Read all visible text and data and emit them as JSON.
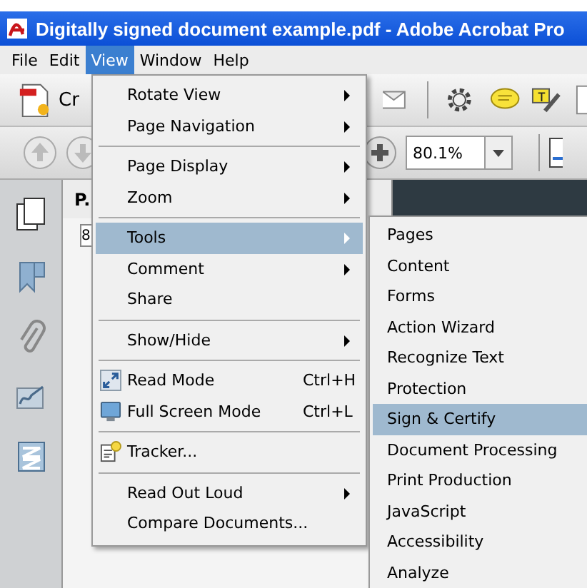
{
  "window": {
    "title": "Digitally signed document example.pdf - Adobe Acrobat Pro"
  },
  "menu_bar": [
    {
      "label": "File",
      "selected": false
    },
    {
      "label": "Edit",
      "selected": false
    },
    {
      "label": "View",
      "selected": true
    },
    {
      "label": "Window",
      "selected": false
    },
    {
      "label": "Help",
      "selected": false
    }
  ],
  "toolbar": {
    "create_label": "Cr",
    "zoom": "80.1%"
  },
  "navigation_pane": {
    "title": "P.",
    "page_field": "8"
  },
  "view_menu": [
    {
      "kind": "submenu",
      "label": "Rotate View",
      "selected": false
    },
    {
      "kind": "submenu",
      "label": "Page Navigation",
      "selected": false
    },
    {
      "kind": "separator"
    },
    {
      "kind": "submenu",
      "label": "Page Display",
      "selected": false
    },
    {
      "kind": "submenu",
      "label": "Zoom",
      "selected": false
    },
    {
      "kind": "separator"
    },
    {
      "kind": "submenu",
      "label": "Tools",
      "selected": true
    },
    {
      "kind": "submenu",
      "label": "Comment",
      "selected": false
    },
    {
      "kind": "command",
      "label": "Share",
      "selected": false
    },
    {
      "kind": "separator"
    },
    {
      "kind": "submenu",
      "label": "Show/Hide",
      "selected": false
    },
    {
      "kind": "separator"
    },
    {
      "kind": "command",
      "label": "Read Mode",
      "shortcut": "Ctrl+H",
      "selected": false
    },
    {
      "kind": "command",
      "label": "Full Screen Mode",
      "shortcut": "Ctrl+L",
      "selected": false
    },
    {
      "kind": "separator"
    },
    {
      "kind": "command",
      "label": "Tracker...",
      "selected": false
    },
    {
      "kind": "separator"
    },
    {
      "kind": "submenu",
      "label": "Read Out Loud",
      "selected": false
    },
    {
      "kind": "command",
      "label": "Compare Documents...",
      "selected": false
    }
  ],
  "tools_submenu": [
    {
      "label": "Pages",
      "selected": false
    },
    {
      "label": "Content",
      "selected": false
    },
    {
      "label": "Forms",
      "selected": false
    },
    {
      "label": "Action Wizard",
      "selected": false
    },
    {
      "label": "Recognize Text",
      "selected": false
    },
    {
      "label": "Protection",
      "selected": false
    },
    {
      "label": "Sign & Certify",
      "selected": true
    },
    {
      "label": "Document Processing",
      "selected": false
    },
    {
      "label": "Print Production",
      "selected": false
    },
    {
      "label": "JavaScript",
      "selected": false
    },
    {
      "label": "Accessibility",
      "selected": false
    },
    {
      "label": "Analyze",
      "selected": false
    }
  ]
}
